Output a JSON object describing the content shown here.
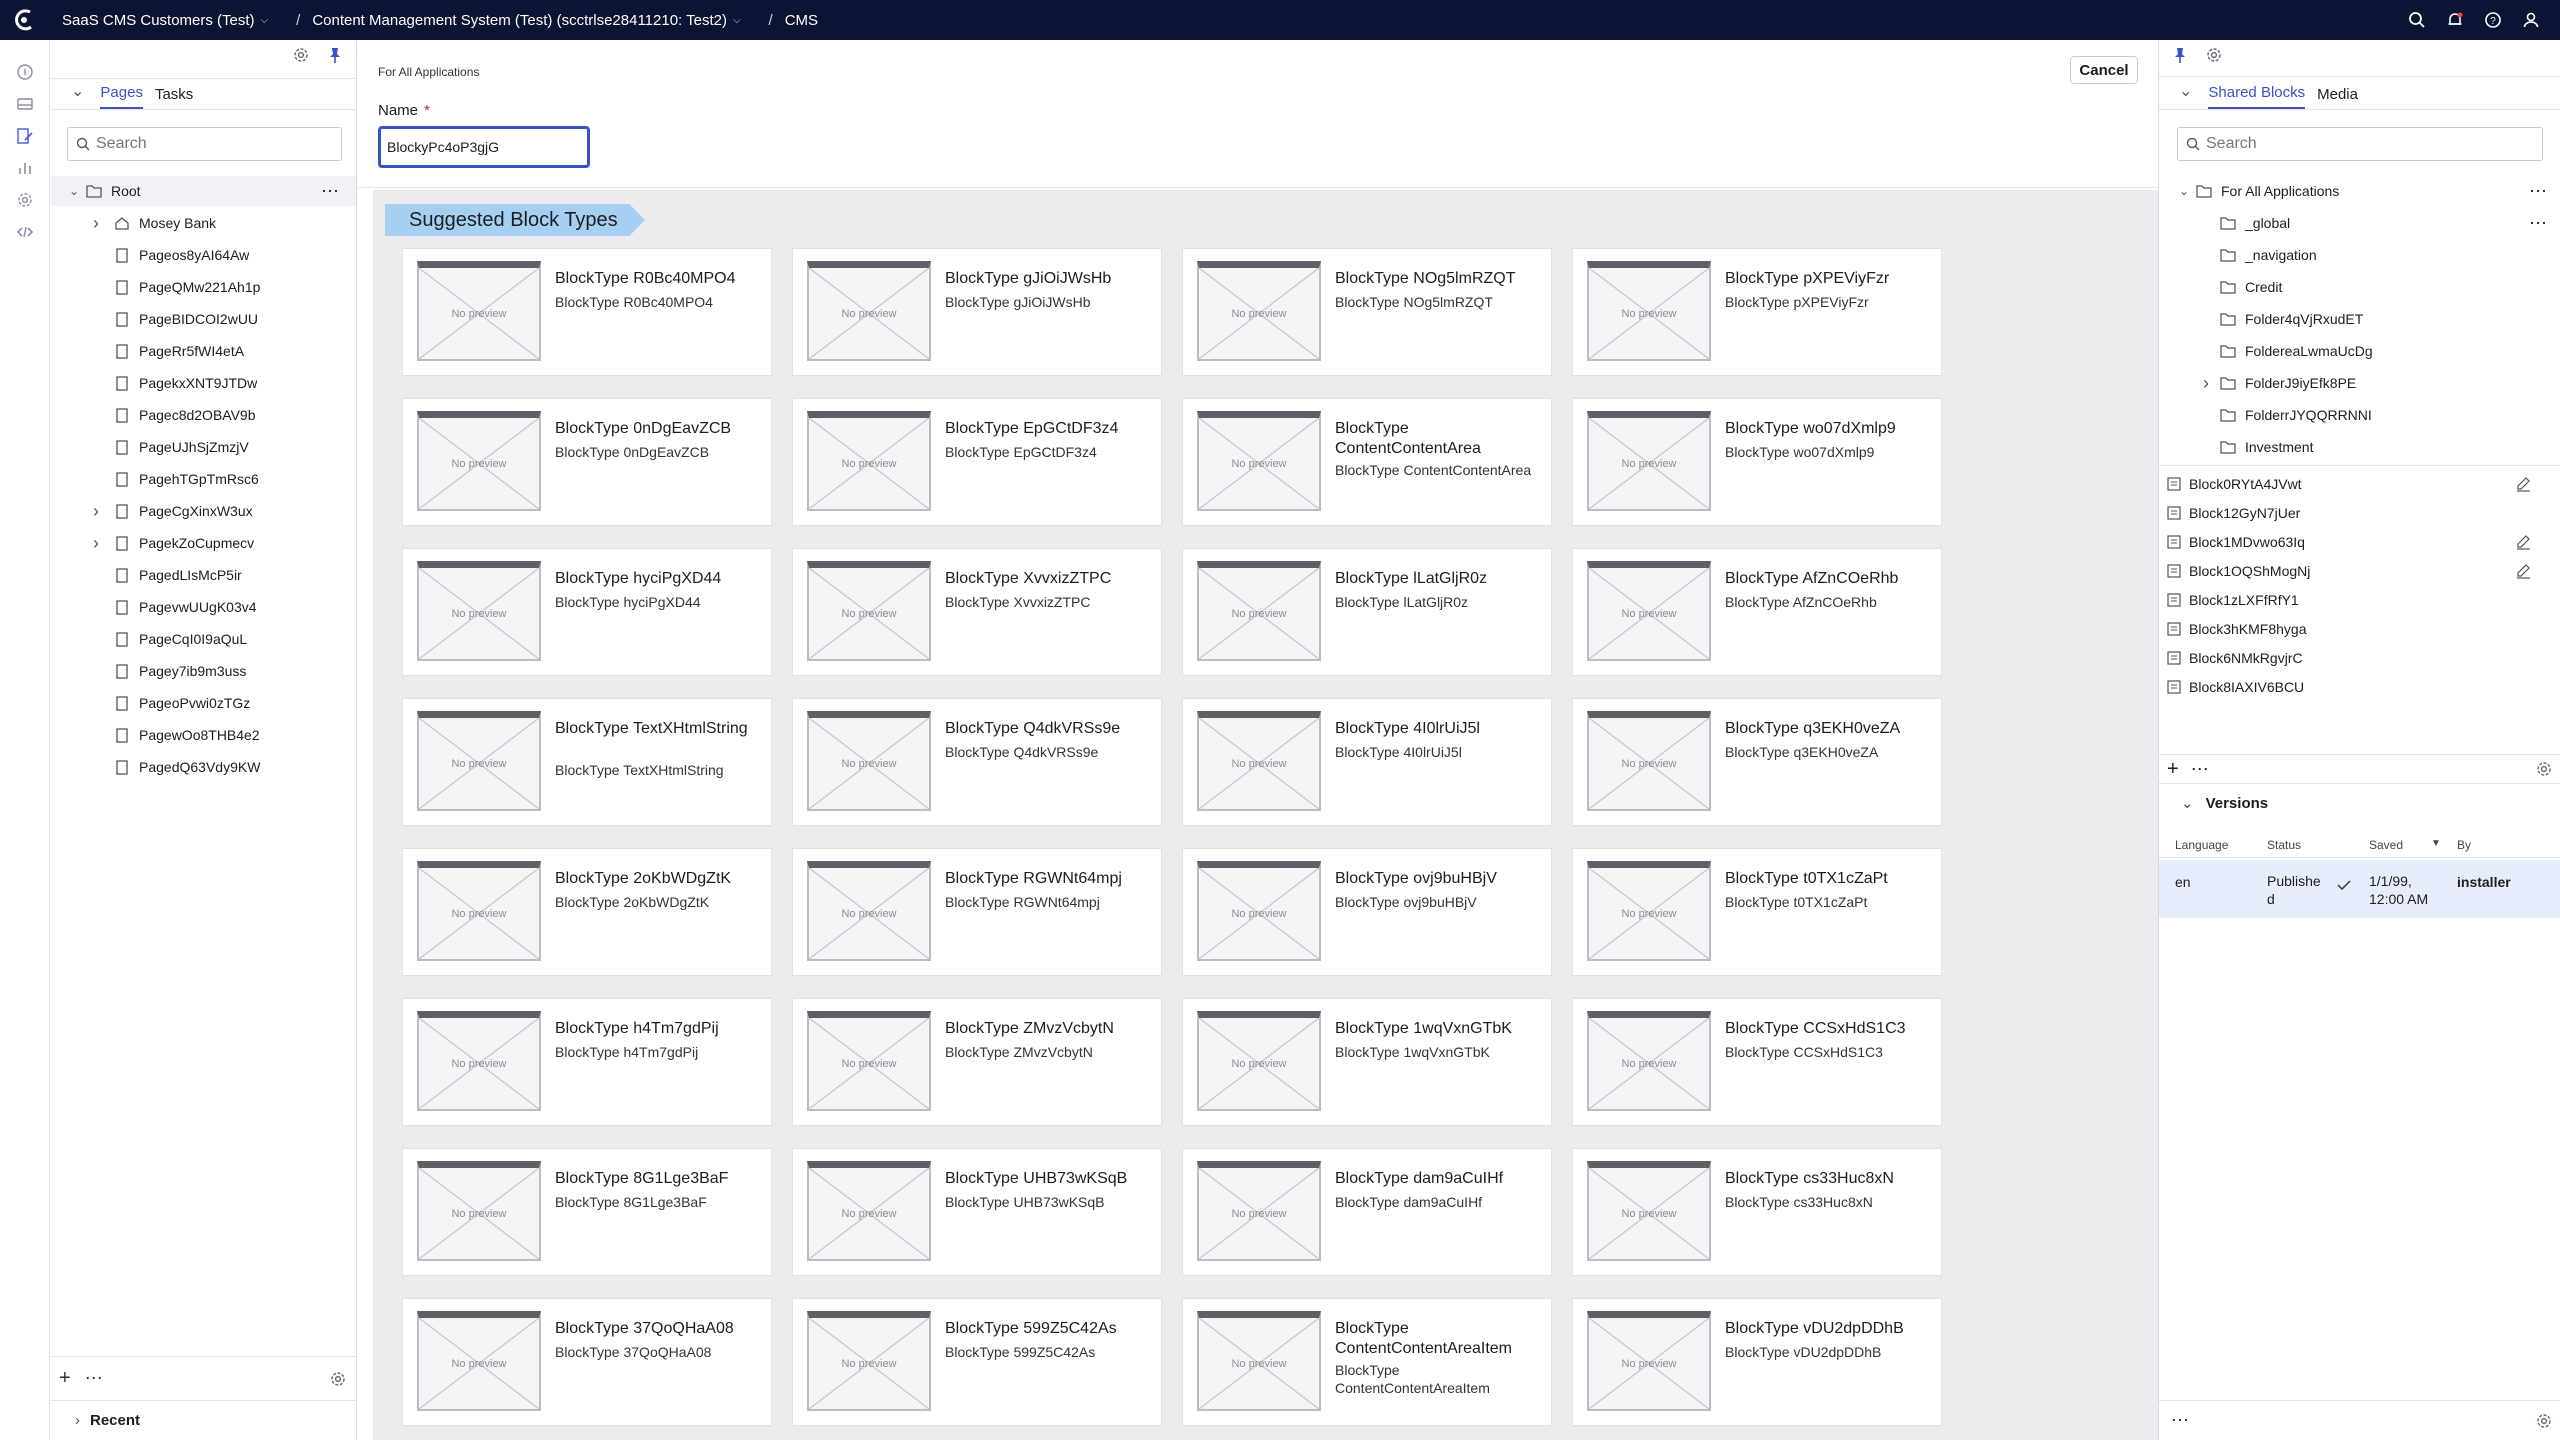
{
  "topbar": {
    "crumbs": [
      "SaaS CMS Customers (Test)",
      "Content Management System (Test) (scctrlse28411210: Test2)",
      "CMS"
    ]
  },
  "left_panel": {
    "tabs": [
      "Pages",
      "Tasks"
    ],
    "search_placeholder": "Search",
    "root_label": "Root",
    "items": [
      {
        "label": "Mosey Bank",
        "expandable": true,
        "icon": "home-icon"
      },
      {
        "label": "Pageos8yAI64Aw",
        "expandable": false,
        "icon": "page-icon"
      },
      {
        "label": "PageQMw221Ah1p",
        "expandable": false,
        "icon": "page-icon"
      },
      {
        "label": "PageBIDCOI2wUU",
        "expandable": false,
        "icon": "page-icon"
      },
      {
        "label": "PageRr5fWI4etA",
        "expandable": false,
        "icon": "page-icon"
      },
      {
        "label": "PagekxXNT9JTDw",
        "expandable": false,
        "icon": "page-icon"
      },
      {
        "label": "Pagec8d2OBAV9b",
        "expandable": false,
        "icon": "page-icon"
      },
      {
        "label": "PageUJhSjZmzjV",
        "expandable": false,
        "icon": "page-icon"
      },
      {
        "label": "PagehTGpTmRsc6",
        "expandable": false,
        "icon": "page-icon"
      },
      {
        "label": "PageCgXinxW3ux",
        "expandable": true,
        "icon": "page-icon"
      },
      {
        "label": "PagekZoCupmecv",
        "expandable": true,
        "icon": "page-icon"
      },
      {
        "label": "PagedLIsMcP5ir",
        "expandable": false,
        "icon": "page-icon"
      },
      {
        "label": "PagevwUUgK03v4",
        "expandable": false,
        "icon": "page-icon"
      },
      {
        "label": "PageCqI0I9aQuL",
        "expandable": false,
        "icon": "page-icon"
      },
      {
        "label": "Pagey7ib9m3uss",
        "expandable": false,
        "icon": "page-icon"
      },
      {
        "label": "PageoPvwi0zTGz",
        "expandable": false,
        "icon": "page-icon"
      },
      {
        "label": "PagewOo8THB4e2",
        "expandable": false,
        "icon": "page-icon"
      },
      {
        "label": "PagedQ63Vdy9KW",
        "expandable": false,
        "icon": "page-icon"
      }
    ],
    "recent_label": "Recent"
  },
  "main": {
    "subheader": "For All Applications",
    "cancel_label": "Cancel",
    "name_label": "Name",
    "name_required": "*",
    "name_value": "BlockyPc4oP3gjG",
    "banner": "Suggested Block Types",
    "no_preview": "No preview",
    "cards": [
      {
        "title": "BlockType R0Bc40MPO4",
        "desc": "BlockType R0Bc40MPO4"
      },
      {
        "title": "BlockType gJiOiJWsHb",
        "desc": "BlockType gJiOiJWsHb"
      },
      {
        "title": "BlockType NOg5lmRZQT",
        "desc": "BlockType NOg5lmRZQT"
      },
      {
        "title": "BlockType pXPEViyFzr",
        "desc": "BlockType pXPEViyFzr"
      },
      {
        "title": "BlockType 0nDgEavZCB",
        "desc": "BlockType 0nDgEavZCB"
      },
      {
        "title": "BlockType EpGCtDF3z4",
        "desc": "BlockType EpGCtDF3z4"
      },
      {
        "title": "BlockType ContentContentArea",
        "desc": "BlockType ContentContentArea"
      },
      {
        "title": "BlockType wo07dXmlp9",
        "desc": "BlockType wo07dXmlp9"
      },
      {
        "title": "BlockType hyciPgXD44",
        "desc": "BlockType hyciPgXD44"
      },
      {
        "title": "BlockType XvvxizZTPC",
        "desc": "BlockType XvvxizZTPC"
      },
      {
        "title": "BlockType lLatGljR0z",
        "desc": "BlockType lLatGljR0z"
      },
      {
        "title": "BlockType AfZnCOeRhb",
        "desc": "BlockType AfZnCOeRhb"
      },
      {
        "title": "BlockType TextXHtmlString",
        "desc": "BlockType TextXHtmlString"
      },
      {
        "title": "BlockType Q4dkVRSs9e",
        "desc": "BlockType Q4dkVRSs9e"
      },
      {
        "title": "BlockType 4I0lrUiJ5l",
        "desc": "BlockType 4I0lrUiJ5l"
      },
      {
        "title": "BlockType q3EKH0veZA",
        "desc": "BlockType q3EKH0veZA"
      },
      {
        "title": "BlockType 2oKbWDgZtK",
        "desc": "BlockType 2oKbWDgZtK"
      },
      {
        "title": "BlockType RGWNt64mpj",
        "desc": "BlockType RGWNt64mpj"
      },
      {
        "title": "BlockType ovj9buHBjV",
        "desc": "BlockType ovj9buHBjV"
      },
      {
        "title": "BlockType t0TX1cZaPt",
        "desc": "BlockType t0TX1cZaPt"
      },
      {
        "title": "BlockType h4Tm7gdPij",
        "desc": "BlockType h4Tm7gdPij"
      },
      {
        "title": "BlockType ZMvzVcbytN",
        "desc": "BlockType ZMvzVcbytN"
      },
      {
        "title": "BlockType 1wqVxnGTbK",
        "desc": "BlockType 1wqVxnGTbK"
      },
      {
        "title": "BlockType CCSxHdS1C3",
        "desc": "BlockType CCSxHdS1C3"
      },
      {
        "title": "BlockType 8G1Lge3BaF",
        "desc": "BlockType 8G1Lge3BaF"
      },
      {
        "title": "BlockType UHB73wKSqB",
        "desc": "BlockType UHB73wKSqB"
      },
      {
        "title": "BlockType dam9aCuIHf",
        "desc": "BlockType dam9aCuIHf"
      },
      {
        "title": "BlockType cs33Huc8xN",
        "desc": "BlockType cs33Huc8xN"
      },
      {
        "title": "BlockType 37QoQHaA08",
        "desc": "BlockType 37QoQHaA08"
      },
      {
        "title": "BlockType 599Z5C42As",
        "desc": "BlockType 599Z5C42As"
      },
      {
        "title": "BlockType ContentContentAreaItem",
        "desc": "BlockType ContentContentAreaItem"
      },
      {
        "title": "BlockType vDU2dpDDhB",
        "desc": "BlockType vDU2dpDDhB"
      }
    ]
  },
  "right_panel": {
    "tabs": [
      "Shared Blocks",
      "Media"
    ],
    "search_placeholder": "Search",
    "root_label": "For All Applications",
    "folders": [
      {
        "label": "_global",
        "expandable": false
      },
      {
        "label": "_navigation",
        "expandable": false
      },
      {
        "label": "Credit",
        "expandable": false
      },
      {
        "label": "Folder4qVjRxudET",
        "expandable": false
      },
      {
        "label": "FoldereaLwmaUcDg",
        "expandable": false
      },
      {
        "label": "FolderJ9iyEfk8PE",
        "expandable": true
      },
      {
        "label": "FolderrJYQQRRNNI",
        "expandable": false
      },
      {
        "label": "Investment",
        "expandable": false
      }
    ],
    "blocks": [
      {
        "label": "Block0RYtA4JVwt",
        "editable": true
      },
      {
        "label": "Block12GyN7jUer",
        "editable": false
      },
      {
        "label": "Block1MDvwo63Iq",
        "editable": true
      },
      {
        "label": "Block1OQShMogNj",
        "editable": true
      },
      {
        "label": "Block1zLXFfRfY1",
        "editable": false
      },
      {
        "label": "Block3hKMF8hyga",
        "editable": false
      },
      {
        "label": "Block6NMkRgvjrC",
        "editable": false
      },
      {
        "label": "Block8IAXIV6BCU",
        "editable": false
      }
    ],
    "versions": {
      "heading": "Versions",
      "columns": [
        "Language",
        "Status",
        "Saved",
        "By"
      ],
      "row": {
        "language": "en",
        "status": "Publishe d",
        "saved": "1/1/99, 12:00 AM",
        "by": "installer"
      }
    }
  },
  "colors": {
    "topbar": "#0b1432",
    "accent": "#3a52c6",
    "banner": "#a6d0f2",
    "required": "#d7252e"
  }
}
